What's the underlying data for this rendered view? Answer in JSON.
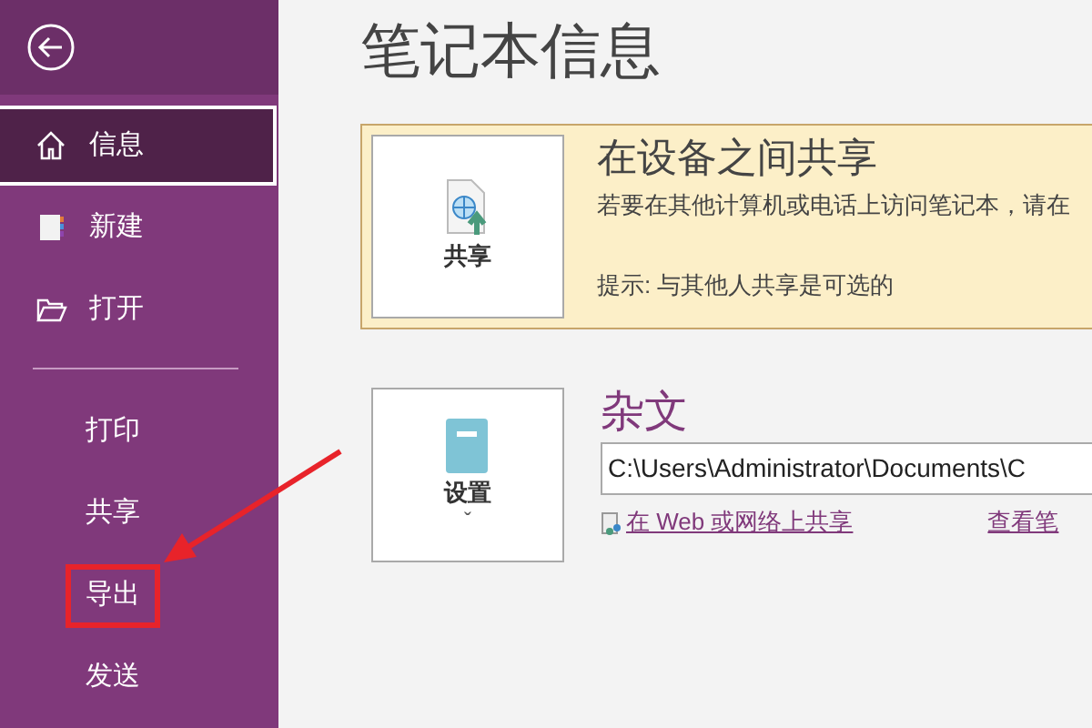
{
  "sidebar": {
    "items": [
      {
        "label": "信息",
        "kind": "home",
        "selected": true
      },
      {
        "label": "新建",
        "kind": "notebook",
        "selected": false
      },
      {
        "label": "打开",
        "kind": "folder",
        "selected": false
      }
    ],
    "secondary_items": [
      {
        "label": "打印",
        "selected": false,
        "highlighted": false
      },
      {
        "label": "共享",
        "selected": false,
        "highlighted": false
      },
      {
        "label": "导出",
        "selected": false,
        "highlighted": true
      },
      {
        "label": "发送",
        "selected": false,
        "highlighted": false
      }
    ]
  },
  "page_title": "笔记本信息",
  "share_panel": {
    "button_label": "共享",
    "title": "在设备之间共享",
    "description": "若要在其他计算机或电话上访问笔记本，请在",
    "tip": "提示: 与其他人共享是可选的"
  },
  "notebook": {
    "button_label": "设置",
    "button_caret": "ˇ",
    "name": "杂文",
    "path": "C:\\Users\\Administrator\\Documents\\C",
    "share_link": "在 Web 或网络上共享",
    "view_link": "查看笔"
  }
}
